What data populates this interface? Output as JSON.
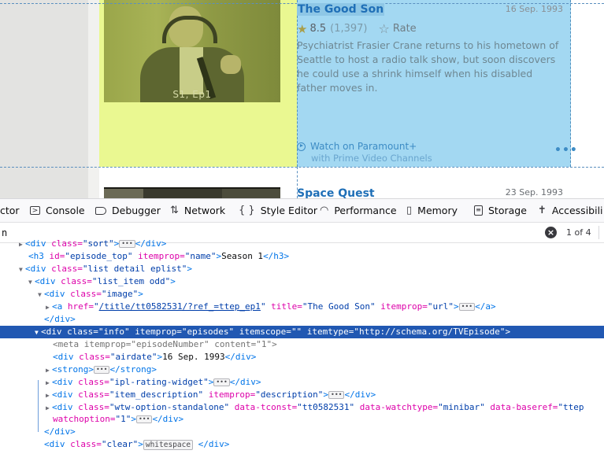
{
  "preview": {
    "thumbnail_caption": "S1, Ep1",
    "episode": {
      "title": "The Good Son",
      "airdate": "16 Sep. 1993",
      "rating": "8.5",
      "vote_count": "(1,397)",
      "rate_label": "Rate",
      "description": "Psychiatrist Frasier Crane returns to his hometown of Seattle to host a radio talk show, but soon discovers he could use a shrink himself when his disabled father moves in.",
      "watch_label": "Watch on Paramount+",
      "watch_sub": "with Prime Video Channels",
      "more": "•••"
    },
    "next_episode": {
      "title": "Space Quest",
      "airdate": "23 Sep. 1993"
    }
  },
  "devtools": {
    "tabs": [
      {
        "label": "ctor",
        "icon": "inspector-icon"
      },
      {
        "label": "Console",
        "icon": "console-icon"
      },
      {
        "label": "Debugger",
        "icon": "debugger-icon"
      },
      {
        "label": "Network",
        "icon": "network-icon"
      },
      {
        "label": "Style Editor",
        "icon": "braces-icon"
      },
      {
        "label": "Performance",
        "icon": "gauge-icon"
      },
      {
        "label": "Memory",
        "icon": "chip-icon"
      },
      {
        "label": "Storage",
        "icon": "storage-icon"
      },
      {
        "label": "Accessibili",
        "icon": "accessibility-icon"
      }
    ],
    "search": {
      "value": "n",
      "match_count": "1 of 4"
    },
    "markup": {
      "l0_tag": "<div",
      "l0_attr": " class=",
      "l0_val": "\"sort\"",
      "l0_gt": ">",
      "l0_badge": "•••",
      "l0_close": "</div>",
      "l1_open": "<h3",
      "l1_attr1": " id=",
      "l1_val1": "\"episode_top\"",
      "l1_attr2": " itemprop=",
      "l1_val2": "\"name\"",
      "l1_gt": ">",
      "l1_text": "Season 1",
      "l1_close": "</h3>",
      "l2_tag": "<div",
      "l2_attr": " class=",
      "l2_val": "\"list detail eplist\"",
      "l2_gt": ">",
      "l3_tag": "<div",
      "l3_attr": " class=",
      "l3_val": "\"list_item odd\"",
      "l3_gt": ">",
      "l4_tag": "<div",
      "l4_attr": " class=",
      "l4_val": "\"image\"",
      "l4_gt": ">",
      "l5_tag": "<a",
      "l5_attr1": " href=",
      "l5_val1a": "\"",
      "l5_val1b": "/title/tt0582531/?ref_=ttep_ep1",
      "l5_val1c": "\"",
      "l5_attr2": " title=",
      "l5_val2": "\"The Good Son\"",
      "l5_attr3": " itemprop=",
      "l5_val3": "\"url\"",
      "l5_gt": ">",
      "l5_badge": "•••",
      "l5_close": "</a>",
      "l6_close": "</div>",
      "l7_tag": "<div",
      "l7_attr1": " class=",
      "l7_val1": "\"info\"",
      "l7_attr2": " itemprop=",
      "l7_val2": "\"episodes\"",
      "l7_attr3": " itemscope=",
      "l7_val3": "\"\"",
      "l7_attr4": " itemtype=",
      "l7_val4": "\"http://schema.org/TVEpisode\"",
      "l7_gt": ">",
      "l8_text": "<meta itemprop=\"episodeNumber\" content=\"1\">",
      "l9_tag": "<div",
      "l9_attr": " class=",
      "l9_val": "\"airdate\"",
      "l9_gt": ">",
      "l9_text": "16 Sep. 1993",
      "l9_close": "</div>",
      "l10_tag": "<strong>",
      "l10_badge": "•••",
      "l10_close": "</strong>",
      "l11_tag": "<div",
      "l11_attr": " class=",
      "l11_val": "\"ipl-rating-widget\"",
      "l11_gt": ">",
      "l11_badge": "•••",
      "l11_close": "</div>",
      "l12_tag": "<div",
      "l12_attr1": " class=",
      "l12_val1": "\"item_description\"",
      "l12_attr2": " itemprop=",
      "l12_val2": "\"description\"",
      "l12_gt": ">",
      "l12_badge": "•••",
      "l12_close": "</div>",
      "l13_tag": "<div",
      "l13_attr1": " class=",
      "l13_val1": "\"wtw-option-standalone\"",
      "l13_attr2": " data-tconst=",
      "l13_val2": "\"tt0582531\"",
      "l13_attr3": " data-watchtype=",
      "l13_val3": "\"minibar\"",
      "l13_attr4": " data-baseref=",
      "l13_val4": "\"ttep",
      "l14_attr": "watchoption=",
      "l14_val": "\"1\"",
      "l14_gt": ">",
      "l14_badge": "•••",
      "l14_close": "</div>",
      "l15_close": "</div>",
      "l16_tag": "<div",
      "l16_attr": " class=",
      "l16_val": "\"clear\"",
      "l16_gt": ">",
      "l16_badge": "whitespace",
      "l16_close": " </div>"
    }
  }
}
